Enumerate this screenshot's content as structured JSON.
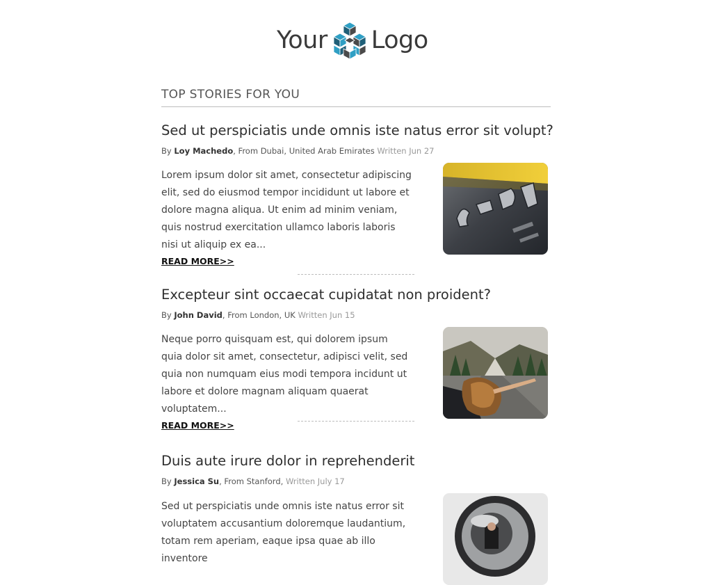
{
  "header": {
    "logo_left": "Your",
    "logo_right": "Logo"
  },
  "section_title": "TOP STORIES FOR YOU",
  "stories": [
    {
      "title": "Sed ut perspiciatis unde omnis iste natus error sit volupt?",
      "by": "By",
      "author": "Loy Machedo",
      "from": ", From Dubai, United Arab Emirates",
      "written": "Written Jun 27",
      "excerpt": "Lorem ipsum dolor sit amet, consectetur adipiscing elit, sed do eiusmod tempor incididunt ut labore et dolore magna aliqua. Ut enim ad minim veniam, quis nostrud exercitation ullamco laboris laboris nisi ut aliquip ex ea...",
      "read_more": "READ MORE>>"
    },
    {
      "title": "Excepteur sint occaecat cupidatat non proident?",
      "by": "By",
      "author": "John David",
      "from": ", From London, UK",
      "written": "Written Jun 15",
      "excerpt": "Neque porro quisquam est, qui dolorem ipsum quia dolor sit amet, consectetur, adipisci velit, sed quia non numquam eius modi tempora incidunt ut labore et dolore magnam aliquam quaerat voluptatem...",
      "read_more": "READ MORE>>"
    },
    {
      "title": "Duis aute irure dolor in reprehenderit",
      "by": "By",
      "author": "Jessica Su",
      "from": ", From Stanford,",
      "written": "Written July 17",
      "excerpt": "Sed ut perspiciatis unde omnis iste natus error sit voluptatem accusantium doloremque laudantium, totam rem aperiam, eaque ipsa quae ab illo inventore"
    }
  ],
  "colors": {
    "logo_blue": "#2f9fc4",
    "logo_dark": "#1f5f78",
    "divider": "#bdbdbd"
  }
}
